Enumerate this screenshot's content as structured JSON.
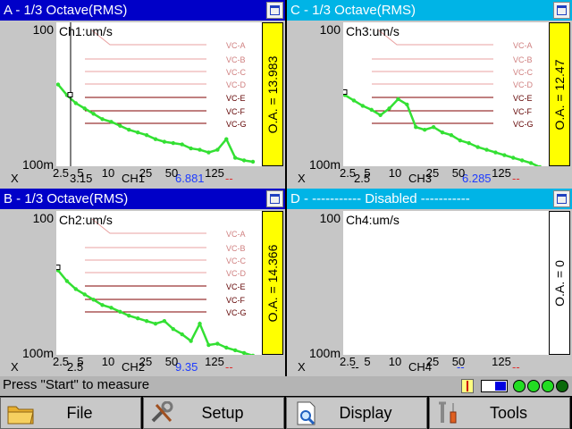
{
  "panels": [
    {
      "key": "a",
      "title": "A - 1/3 Octave(RMS)",
      "ch_label": "Ch1:um/s",
      "y_top": "100",
      "y_bottom": "100m",
      "oa": "O.A. = 13.983",
      "x_label": "X",
      "x_value": "3.15",
      "ch": "CH1",
      "ch_value": "6.881",
      "dash": "--",
      "series": [
        0.44,
        0.52,
        0.58,
        0.62,
        0.66,
        0.7,
        0.72,
        0.75,
        0.78,
        0.8,
        0.82,
        0.85,
        0.87,
        0.88,
        0.89,
        0.92,
        0.93,
        0.95,
        0.93,
        0.85,
        0.99,
        1.01,
        1.02
      ]
    },
    {
      "key": "c",
      "title": "C - 1/3 Octave(RMS)",
      "ch_label": "Ch3:um/s",
      "y_top": "100",
      "y_bottom": "100m",
      "oa": "O.A. = 12.47",
      "x_label": "X",
      "x_value": "2.5",
      "ch": "CH3",
      "ch_value": "6.285",
      "dash": "--",
      "series": [
        0.52,
        0.56,
        0.6,
        0.63,
        0.67,
        0.62,
        0.55,
        0.59,
        0.76,
        0.78,
        0.76,
        0.8,
        0.82,
        0.86,
        0.88,
        0.91,
        0.93,
        0.95,
        0.97,
        0.99,
        1.01,
        1.03,
        1.06
      ]
    },
    {
      "key": "b",
      "title": "B - 1/3 Octave(RMS)",
      "ch_label": "Ch2:um/s",
      "y_top": "100",
      "y_bottom": "100m",
      "oa": "O.A. = 14.366",
      "x_label": "X",
      "x_value": "2.5",
      "ch": "CH2",
      "ch_value": "9.35",
      "dash": "--",
      "series": [
        0.42,
        0.5,
        0.56,
        0.6,
        0.64,
        0.68,
        0.7,
        0.73,
        0.76,
        0.78,
        0.8,
        0.82,
        0.8,
        0.86,
        0.9,
        0.95,
        0.82,
        0.98,
        0.97,
        1.0,
        1.02,
        1.04,
        1.06
      ]
    },
    {
      "key": "d",
      "title": "D - ----------- Disabled -----------",
      "ch_label": "Ch4:um/s",
      "y_top": "100",
      "y_bottom": "100m",
      "oa": "O.A. = 0",
      "x_label": "X",
      "x_value": "--",
      "ch": "CH4",
      "ch_value": "--",
      "dash": "--",
      "series": [
        1.08,
        1.08,
        1.08,
        1.08,
        1.08,
        1.08,
        1.08,
        1.08,
        1.08,
        1.08,
        1.08,
        1.08,
        1.08,
        1.08,
        1.08,
        1.08,
        1.08,
        1.08,
        1.08,
        1.08,
        1.08,
        1.08,
        1.08
      ]
    }
  ],
  "x_ticks": [
    "2.5",
    "5",
    "10",
    "25",
    "50",
    "125"
  ],
  "vc_labels": [
    "VC-A",
    "VC-B",
    "VC-C",
    "VC-D",
    "VC-E",
    "VC-F",
    "VC-G"
  ],
  "status": {
    "text": "Press \"Start\" to measure"
  },
  "toolbar": {
    "file": "File",
    "setup": "Setup",
    "display": "Display",
    "tools": "Tools"
  },
  "colors": {
    "panel_a_b": "#0000c8",
    "panel_c_d": "#00b4e6",
    "series": "#33e033",
    "oa_bg": "#ffff00"
  }
}
